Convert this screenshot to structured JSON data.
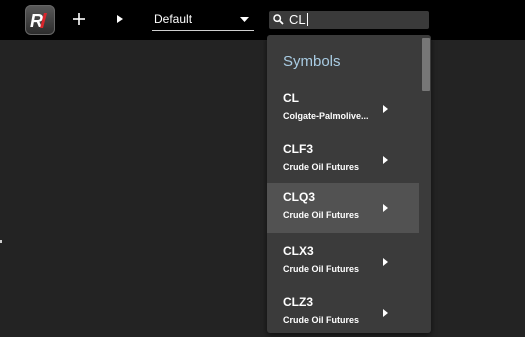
{
  "app": {
    "logo_text": "R1",
    "layout_select": {
      "value": "Default"
    },
    "search": {
      "value": "CL"
    }
  },
  "dropdown": {
    "heading": "Symbols",
    "items": [
      {
        "code": "CL",
        "description": "Colgate-Palmolive..."
      },
      {
        "code": "CLF3",
        "description": "Crude Oil Futures"
      },
      {
        "code": "CLQ3",
        "description": "Crude Oil Futures"
      },
      {
        "code": "CLX3",
        "description": "Crude Oil Futures"
      },
      {
        "code": "CLZ3",
        "description": "Crude Oil Futures"
      }
    ],
    "highlighted_index": 2
  },
  "colors": {
    "topbar": "#000000",
    "background": "#232323",
    "dropdown": "#3b3b3b",
    "row_highlight": "#525252",
    "heading": "#a9cce3",
    "logo_accent": "#d8262c"
  }
}
